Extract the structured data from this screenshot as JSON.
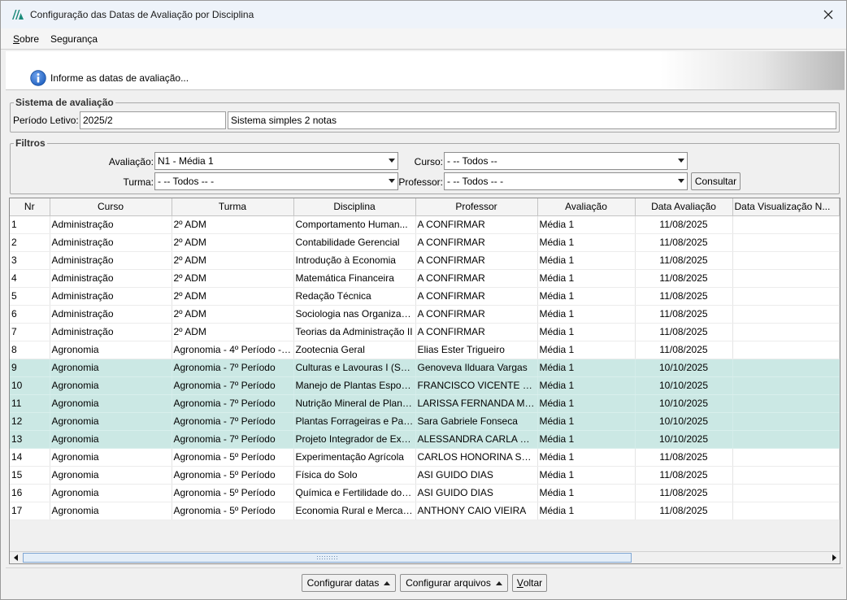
{
  "window": {
    "title": "Configuração das Datas de Avaliação por Disciplina"
  },
  "menu": {
    "sobre_first": "S",
    "sobre_rest": "obre",
    "seguranca": "Segurança"
  },
  "banner": {
    "text": "Informe as datas de avaliação..."
  },
  "sistema": {
    "legend": "Sistema de avaliação",
    "periodo_label": "Período Letivo:",
    "periodo_value": "2025/2",
    "sistema_value": "Sistema simples 2 notas"
  },
  "filtros": {
    "legend": "Filtros",
    "avaliacao_label": "Avaliação:",
    "avaliacao_value": "N1 - Média 1",
    "curso_label": "Curso:",
    "curso_value": "- -- Todos --",
    "turma_label": "Turma:",
    "turma_value": "- -- Todos -- -",
    "professor_label": "Professor:",
    "professor_value": "- -- Todos -- -",
    "consultar_label": "Consultar"
  },
  "table": {
    "columns": [
      "Nr",
      "Curso",
      "Turma",
      "Disciplina",
      "Professor",
      "Avaliação",
      "Data Avaliação",
      "Data Visualização N..."
    ],
    "rows": [
      {
        "nr": "1",
        "curso": "Administração",
        "turma": "2º ADM",
        "disciplina": "Comportamento Human...",
        "professor": "A CONFIRMAR",
        "avaliacao": "Média 1",
        "data": "11/08/2025",
        "visualizacao": ""
      },
      {
        "nr": "2",
        "curso": "Administração",
        "turma": "2º ADM",
        "disciplina": "Contabilidade Gerencial",
        "professor": "A CONFIRMAR",
        "avaliacao": "Média 1",
        "data": "11/08/2025",
        "visualizacao": ""
      },
      {
        "nr": "3",
        "curso": "Administração",
        "turma": "2º ADM",
        "disciplina": "Introdução à Economia",
        "professor": "A CONFIRMAR",
        "avaliacao": "Média 1",
        "data": "11/08/2025",
        "visualizacao": ""
      },
      {
        "nr": "4",
        "curso": "Administração",
        "turma": "2º ADM",
        "disciplina": "Matemática Financeira",
        "professor": "A CONFIRMAR",
        "avaliacao": "Média 1",
        "data": "11/08/2025",
        "visualizacao": ""
      },
      {
        "nr": "5",
        "curso": "Administração",
        "turma": "2º ADM",
        "disciplina": "Redação Técnica",
        "professor": "A CONFIRMAR",
        "avaliacao": "Média 1",
        "data": "11/08/2025",
        "visualizacao": ""
      },
      {
        "nr": "6",
        "curso": "Administração",
        "turma": "2º ADM",
        "disciplina": "Sociologia nas Organizaç...",
        "professor": "A CONFIRMAR",
        "avaliacao": "Média 1",
        "data": "11/08/2025",
        "visualizacao": ""
      },
      {
        "nr": "7",
        "curso": "Administração",
        "turma": "2º ADM",
        "disciplina": "Teorias da Administração II",
        "professor": "A CONFIRMAR",
        "avaliacao": "Média 1",
        "data": "11/08/2025",
        "visualizacao": ""
      },
      {
        "nr": "8",
        "curso": "Agronomia",
        "turma": "Agronomia - 4º Período - ...",
        "disciplina": "Zootecnia Geral",
        "professor": "Elias Ester Trigueiro",
        "avaliacao": "Média 1",
        "data": "11/08/2025",
        "visualizacao": ""
      },
      {
        "nr": "9",
        "curso": "Agronomia",
        "turma": "Agronomia - 7º Período",
        "disciplina": "Culturas e Lavouras I (Soja...",
        "professor": "Genoveva Ilduara Vargas",
        "avaliacao": "Média 1",
        "data": "10/10/2025",
        "visualizacao": "",
        "highlight": true
      },
      {
        "nr": "10",
        "curso": "Agronomia",
        "turma": "Agronomia - 7º Período",
        "disciplina": "Manejo de Plantas Espont...",
        "professor": "FRANCISCO VICENTE DE L...",
        "avaliacao": "Média 1",
        "data": "10/10/2025",
        "visualizacao": "",
        "highlight": true
      },
      {
        "nr": "11",
        "curso": "Agronomia",
        "turma": "Agronomia - 7º Período",
        "disciplina": "Nutrição Mineral de Plantas",
        "professor": "LARISSA FERNANDA MO...",
        "avaliacao": "Média 1",
        "data": "10/10/2025",
        "visualizacao": "",
        "highlight": true
      },
      {
        "nr": "12",
        "curso": "Agronomia",
        "turma": "Agronomia - 7º Período",
        "disciplina": "Plantas Forrageiras e Past...",
        "professor": "Sara Gabriele Fonseca",
        "avaliacao": "Média 1",
        "data": "10/10/2025",
        "visualizacao": "",
        "highlight": true
      },
      {
        "nr": "13",
        "curso": "Agronomia",
        "turma": "Agronomia - 7º Período",
        "disciplina": "Projeto Integrador de Exte...",
        "professor": "ALESSANDRA CARLA DIAS",
        "avaliacao": "Média 1",
        "data": "10/10/2025",
        "visualizacao": "",
        "highlight": true
      },
      {
        "nr": "14",
        "curso": "Agronomia",
        "turma": "Agronomia - 5º Período",
        "disciplina": "Experimentação Agrícola",
        "professor": "CARLOS HONORINA SAN...",
        "avaliacao": "Média 1",
        "data": "11/08/2025",
        "visualizacao": ""
      },
      {
        "nr": "15",
        "curso": "Agronomia",
        "turma": "Agronomia - 5º Período",
        "disciplina": "Física do Solo",
        "professor": "ASI GUIDO DIAS",
        "avaliacao": "Média 1",
        "data": "11/08/2025",
        "visualizacao": ""
      },
      {
        "nr": "16",
        "curso": "Agronomia",
        "turma": "Agronomia - 5º Período",
        "disciplina": "Química e Fertilidade do S...",
        "professor": "ASI GUIDO DIAS",
        "avaliacao": "Média 1",
        "data": "11/08/2025",
        "visualizacao": ""
      },
      {
        "nr": "17",
        "curso": "Agronomia",
        "turma": "Agronomia - 5º Período",
        "disciplina": "Economia Rural e Mercad...",
        "professor": "ANTHONY CAIO VIEIRA",
        "avaliacao": "Média 1",
        "data": "11/08/2025",
        "visualizacao": ""
      }
    ]
  },
  "footer": {
    "configurar_datas": "Configurar datas",
    "configurar_arquivos": "Configurar arquivos",
    "voltar_first": "V",
    "voltar_rest": "oltar"
  },
  "icons": {
    "app": "app-logo-icon",
    "close": "close-icon",
    "info": "info-icon",
    "dropdown": "chevron-down-icon",
    "popup": "caret-up-icon",
    "scroll_left": "arrow-left-icon",
    "scroll_right": "arrow-right-icon"
  },
  "colors": {
    "highlight_row": "#cbe8e4",
    "titlebar": "#eef3fa",
    "info_blue": "#1f5fbf",
    "scroll_thumb": "#e4eef8"
  }
}
